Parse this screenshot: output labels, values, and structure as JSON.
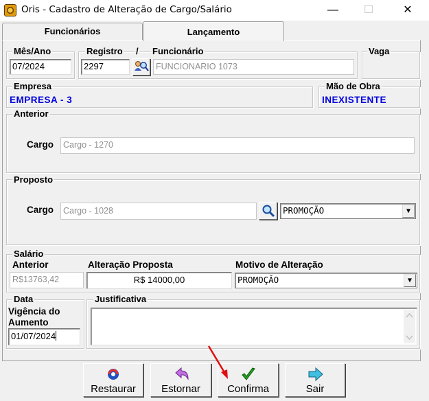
{
  "window": {
    "title": "Oris - Cadastro de Alteração de Cargo/Salário",
    "minimize": "—",
    "maximize": "☐",
    "close": "✕"
  },
  "tabs": [
    {
      "label": "Funcionários",
      "active": false
    },
    {
      "label": "Lançamento",
      "active": true
    }
  ],
  "header": {
    "mes_ano_label": "Mês/Ano",
    "mes_ano_value": "07/2024",
    "registro_label": "Registro",
    "slash": "/",
    "registro_value": "2297",
    "funcionario_label": "Funcionário",
    "funcionario_value": "FUNCIONARIO 1073",
    "vaga_label": "Vaga",
    "empresa_label": "Empresa",
    "empresa_value": "EMPRESA - 3",
    "mao_obra_label": "Mão de Obra",
    "mao_obra_value": "INEXISTENTE"
  },
  "anterior": {
    "group_label": "Anterior",
    "cargo_label": "Cargo",
    "cargo_value": "Cargo - 1270"
  },
  "proposto": {
    "group_label": "Proposto",
    "cargo_label": "Cargo",
    "cargo_value": "Cargo - 1028",
    "motivo_value": "PROMOÇÃO"
  },
  "salario": {
    "group_label": "Salário",
    "anterior_label": "Anterior",
    "anterior_value": "R$13763,42",
    "alteracao_label": "Alteração Proposta",
    "alteracao_value": "R$ 14000,00",
    "motivo_label": "Motivo de Alteração",
    "motivo_value": "PROMOÇÃO"
  },
  "data": {
    "group_label": "Data",
    "vigencia_label_1": "Vigência do",
    "vigencia_label_2": "Aumento",
    "vigencia_value": "01/07/2024"
  },
  "justificativa": {
    "group_label": "Justificativa",
    "value": ""
  },
  "buttons": {
    "restaurar": "Restaurar",
    "estornar": "Estornar",
    "confirma": "Confirma",
    "sair": "Sair"
  },
  "colors": {
    "accent_blue": "#0000e0",
    "annotation_arrow": "#e01010"
  }
}
